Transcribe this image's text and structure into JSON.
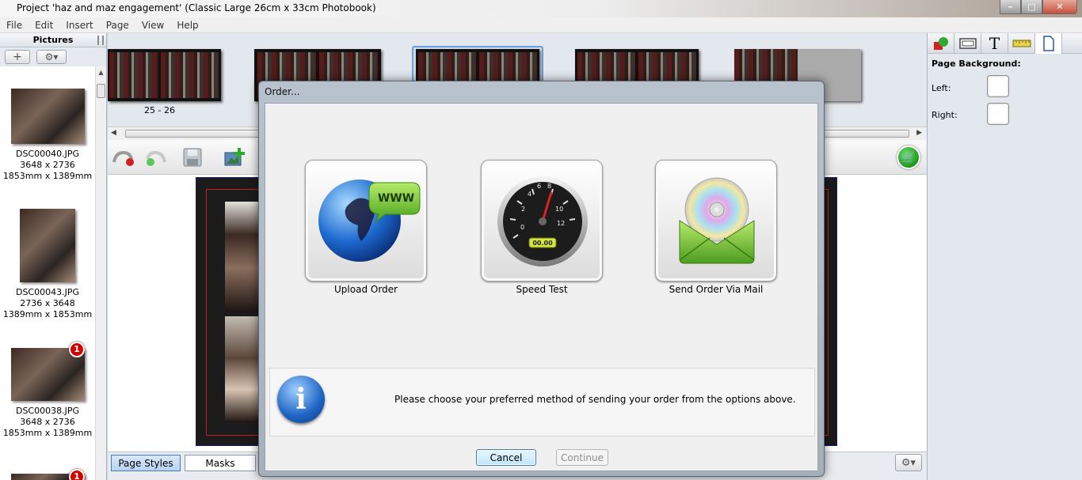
{
  "window": {
    "title": "Project 'haz and maz engagement' (Classic Large 26cm x 33cm Photobook)",
    "controls": {
      "minimize": "–",
      "maximize": "□",
      "close": "✕"
    }
  },
  "menu": [
    "File",
    "Edit",
    "Insert",
    "Page",
    "View",
    "Help"
  ],
  "pictures_panel": {
    "title": "Pictures",
    "add_glyph": "+",
    "settings_glyph": "⚙▾",
    "items": [
      {
        "name": "DSC00040.JPG",
        "pixels": "3648 x 2736",
        "size": "1853mm x 1389mm",
        "badge": ""
      },
      {
        "name": "DSC00043.JPG",
        "pixels": "2736 x 3648",
        "size": "1389mm x 1853mm",
        "badge": ""
      },
      {
        "name": "DSC00038.JPG",
        "pixels": "3648 x 2736",
        "size": "1853mm x 1389mm",
        "badge": "1"
      },
      {
        "name": "",
        "pixels": "",
        "size": "",
        "badge": "1"
      }
    ]
  },
  "page_strip": {
    "spread_label": "25 - 26"
  },
  "toolbar": {
    "icons": [
      "undo-icon",
      "redo-icon",
      "save-icon",
      "add-image-icon",
      "cart-icon"
    ]
  },
  "bottom_tabs": {
    "page_styles": "Page Styles",
    "masks": "Masks",
    "gear_glyph": "⚙▾"
  },
  "right_panel": {
    "tabs": [
      "shapes-icon",
      "frame-icon",
      "text-icon",
      "ruler-icon",
      "page-icon"
    ],
    "text_tab_glyph": "T",
    "page_background": "Page Background:",
    "left_label": "Left:",
    "right_label": "Right:"
  },
  "dialog": {
    "title": "Order...",
    "options": [
      {
        "label": "Upload Order",
        "icon": "globe-www-icon"
      },
      {
        "label": "Speed Test",
        "icon": "speedometer-icon"
      },
      {
        "label": "Send Order Via Mail",
        "icon": "cd-envelope-icon"
      }
    ],
    "www_text": "WWW",
    "speed_readout": "00.00",
    "gauge_ticks": [
      "0",
      "2",
      "4",
      "6",
      "8",
      "10",
      "12"
    ],
    "info_glyph": "i",
    "message": "Please choose your preferred method of sending your order from the options above.",
    "cancel_label": "Cancel",
    "continue_label": "Continue"
  },
  "colors": {
    "accent_blue": "#3c7fb1",
    "badge_red": "#d40000",
    "cart_green": "#1a9a1a"
  }
}
